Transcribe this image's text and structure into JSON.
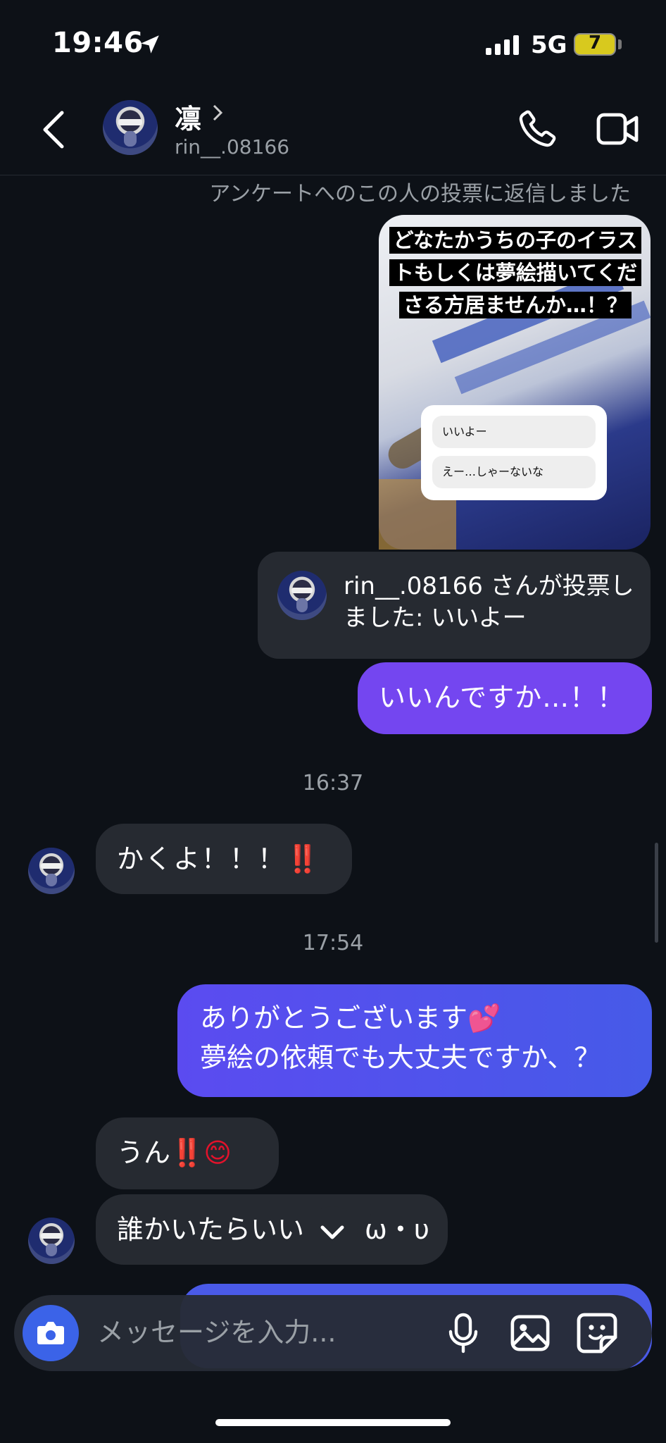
{
  "status_bar": {
    "time": "19:46",
    "network": "5G",
    "battery": "7"
  },
  "header": {
    "name": "凛",
    "username": "rin__.08166"
  },
  "thread": {
    "reply_note": "アンケートへのこの人の投票に返信しました",
    "story": {
      "title": "どなたかうちの子のイラストもしくは夢絵描いてくださる方居ませんか…！？",
      "poll_options": [
        "いいよー",
        "えー…しゃーないな"
      ]
    },
    "vote_notice": "rin__.08166 さんが投票しました: いいよー",
    "messages": [
      {
        "from": "me",
        "text": "いいんですか…！！"
      },
      {
        "type": "timestamp",
        "text": "16:37"
      },
      {
        "from": "them",
        "text": "かくよ！！！",
        "emoji": "‼️"
      },
      {
        "type": "timestamp",
        "text": "17:54"
      },
      {
        "from": "me",
        "line1": "ありがとうございます",
        "line1_emoji": "💕",
        "line2": "夢絵の依頼でも大丈夫ですか、？"
      },
      {
        "from": "them",
        "text": "うん",
        "emoji": "‼️😊"
      },
      {
        "from": "them",
        "text_visible": "誰かいたらいい",
        "text_tail": "ω・υ"
      }
    ]
  },
  "composer": {
    "placeholder": "メッセージを入力..."
  },
  "colors": {
    "background": "#0d1117",
    "outgoing_purple": "#7446f0",
    "outgoing_blue": "#5050ec",
    "incoming": "#262a31",
    "camera_button": "#3b63e8"
  },
  "icons": [
    "location-arrow-icon",
    "signal-icon",
    "battery-icon",
    "back-icon",
    "phone-icon",
    "video-camera-icon",
    "chevron-right-icon",
    "chevron-down-icon",
    "camera-icon",
    "microphone-icon",
    "gallery-icon",
    "sticker-icon"
  ]
}
